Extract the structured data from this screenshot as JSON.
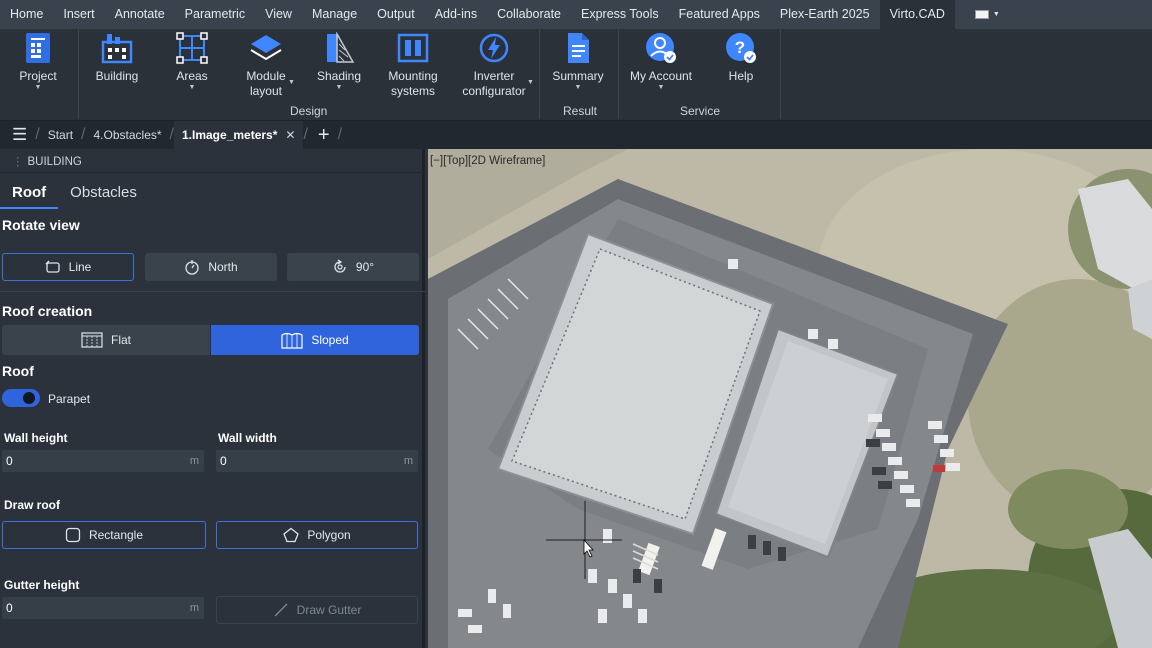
{
  "menubar": {
    "items": [
      "Home",
      "Insert",
      "Annotate",
      "Parametric",
      "View",
      "Manage",
      "Output",
      "Add-ins",
      "Collaborate",
      "Express Tools",
      "Featured Apps",
      "Plex-Earth 2025",
      "Virto.CAD"
    ],
    "active_index": 12
  },
  "ribbon": {
    "project": "Project",
    "building": "Building",
    "areas": "Areas",
    "module_layout": "Module\nlayout",
    "shading": "Shading",
    "mounting": "Mounting\nsystems",
    "inverter": "Inverter\nconfigurator",
    "summary": "Summary",
    "my_account": "My Account",
    "help": "Help",
    "group_design": "Design",
    "group_result": "Result",
    "group_service": "Service",
    "accent": "#2d6fe0"
  },
  "tabs": {
    "start": "Start",
    "obstacles": "4.Obstacles*",
    "active": "1.Image_meters*"
  },
  "panel": {
    "title": "BUILDING",
    "tab_roof": "Roof",
    "tab_obstacles": "Obstacles",
    "rotate_view": "Rotate view",
    "btn_line": "Line",
    "btn_north": "North",
    "btn_90": "90°",
    "roof_creation": "Roof creation",
    "btn_flat": "Flat",
    "btn_sloped": "Sloped",
    "roof": "Roof",
    "parapet": "Parapet",
    "parapet_on": true,
    "wall_height": "Wall height",
    "wall_height_value": "0",
    "wall_width": "Wall width",
    "wall_width_value": "0",
    "unit": "m",
    "draw_roof": "Draw roof",
    "btn_rectangle": "Rectangle",
    "btn_polygon": "Polygon",
    "gutter_height": "Gutter height",
    "gutter_value": "0",
    "btn_draw_gutter": "Draw Gutter"
  },
  "viewport": {
    "label": "[−][Top][2D Wireframe]"
  }
}
